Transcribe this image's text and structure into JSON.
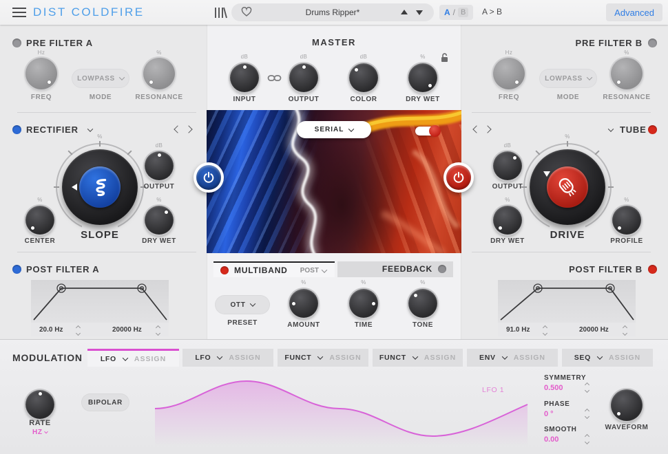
{
  "header": {
    "title": "DIST COLDFIRE",
    "preset_name": "Drums Ripper*",
    "ab_a": "A",
    "ab_sep": "/",
    "ab_b": "B",
    "ab_copy": "A > B",
    "advanced": "Advanced"
  },
  "pre_filter_a": {
    "title": "PRE FILTER A",
    "freq_unit": "Hz",
    "freq": "FREQ",
    "mode_value": "LOWPASS",
    "mode": "MODE",
    "res_unit": "%",
    "res": "RESONANCE"
  },
  "pre_filter_b": {
    "title": "PRE FILTER B",
    "freq_unit": "Hz",
    "freq": "FREQ",
    "mode_value": "LOWPASS",
    "mode": "MODE",
    "res_unit": "%",
    "res": "RESONANCE"
  },
  "master": {
    "title": "MASTER",
    "input_unit": "dB",
    "input": "INPUT",
    "output_unit": "dB",
    "output": "OUTPUT",
    "color_unit": "dB",
    "color": "COLOR",
    "drywet_unit": "%",
    "drywet": "DRY WET"
  },
  "rectifier": {
    "title": "RECTIFIER",
    "center_unit": "%",
    "center": "CENTER",
    "slope_unit": "%",
    "slope": "SLOPE",
    "output_unit": "dB",
    "output": "OUTPUT",
    "drywet_unit": "%",
    "drywet": "DRY WET"
  },
  "tube": {
    "title": "TUBE",
    "output_unit": "dB",
    "output": "OUTPUT",
    "drive_unit": "%",
    "drive": "DRIVE",
    "drywet_unit": "%",
    "drywet": "DRY WET",
    "profile_unit": "%",
    "profile": "PROFILE"
  },
  "routing": {
    "mode": "SERIAL"
  },
  "multiband": {
    "title": "MULTIBAND",
    "position": "POST",
    "preset_value": "OTT",
    "preset": "PRESET",
    "amount_unit": "%",
    "amount": "AMOUNT"
  },
  "feedback": {
    "title": "FEEDBACK",
    "time_unit": "%",
    "time": "TIME",
    "tone_unit": "%",
    "tone": "TONE"
  },
  "post_filter_a": {
    "title": "POST FILTER A",
    "low": "20.0 Hz",
    "high": "20000 Hz"
  },
  "post_filter_b": {
    "title": "POST FILTER B",
    "low": "91.0 Hz",
    "high": "20000 Hz"
  },
  "modulation": {
    "title": "MODULATION",
    "tabs": [
      {
        "label": "LFO",
        "assign": "ASSIGN"
      },
      {
        "label": "LFO",
        "assign": "ASSIGN"
      },
      {
        "label": "FUNCT",
        "assign": "ASSIGN"
      },
      {
        "label": "FUNCT",
        "assign": "ASSIGN"
      },
      {
        "label": "ENV",
        "assign": "ASSIGN"
      },
      {
        "label": "SEQ",
        "assign": "ASSIGN"
      }
    ],
    "rate": "RATE",
    "rate_unit": "HZ",
    "bipolar": "BIPOLAR",
    "wave_name": "LFO 1",
    "symmetry": "SYMMETRY",
    "symmetry_value": "0.500",
    "phase": "PHASE",
    "phase_value": "0 °",
    "smooth": "SMOOTH",
    "smooth_value": "0.00",
    "waveform": "WAVEFORM"
  },
  "colors": {
    "blue": "#2e6bd6",
    "red": "#d6291c",
    "magenta": "#e35ccb",
    "title_blue": "#4f9fe9"
  }
}
